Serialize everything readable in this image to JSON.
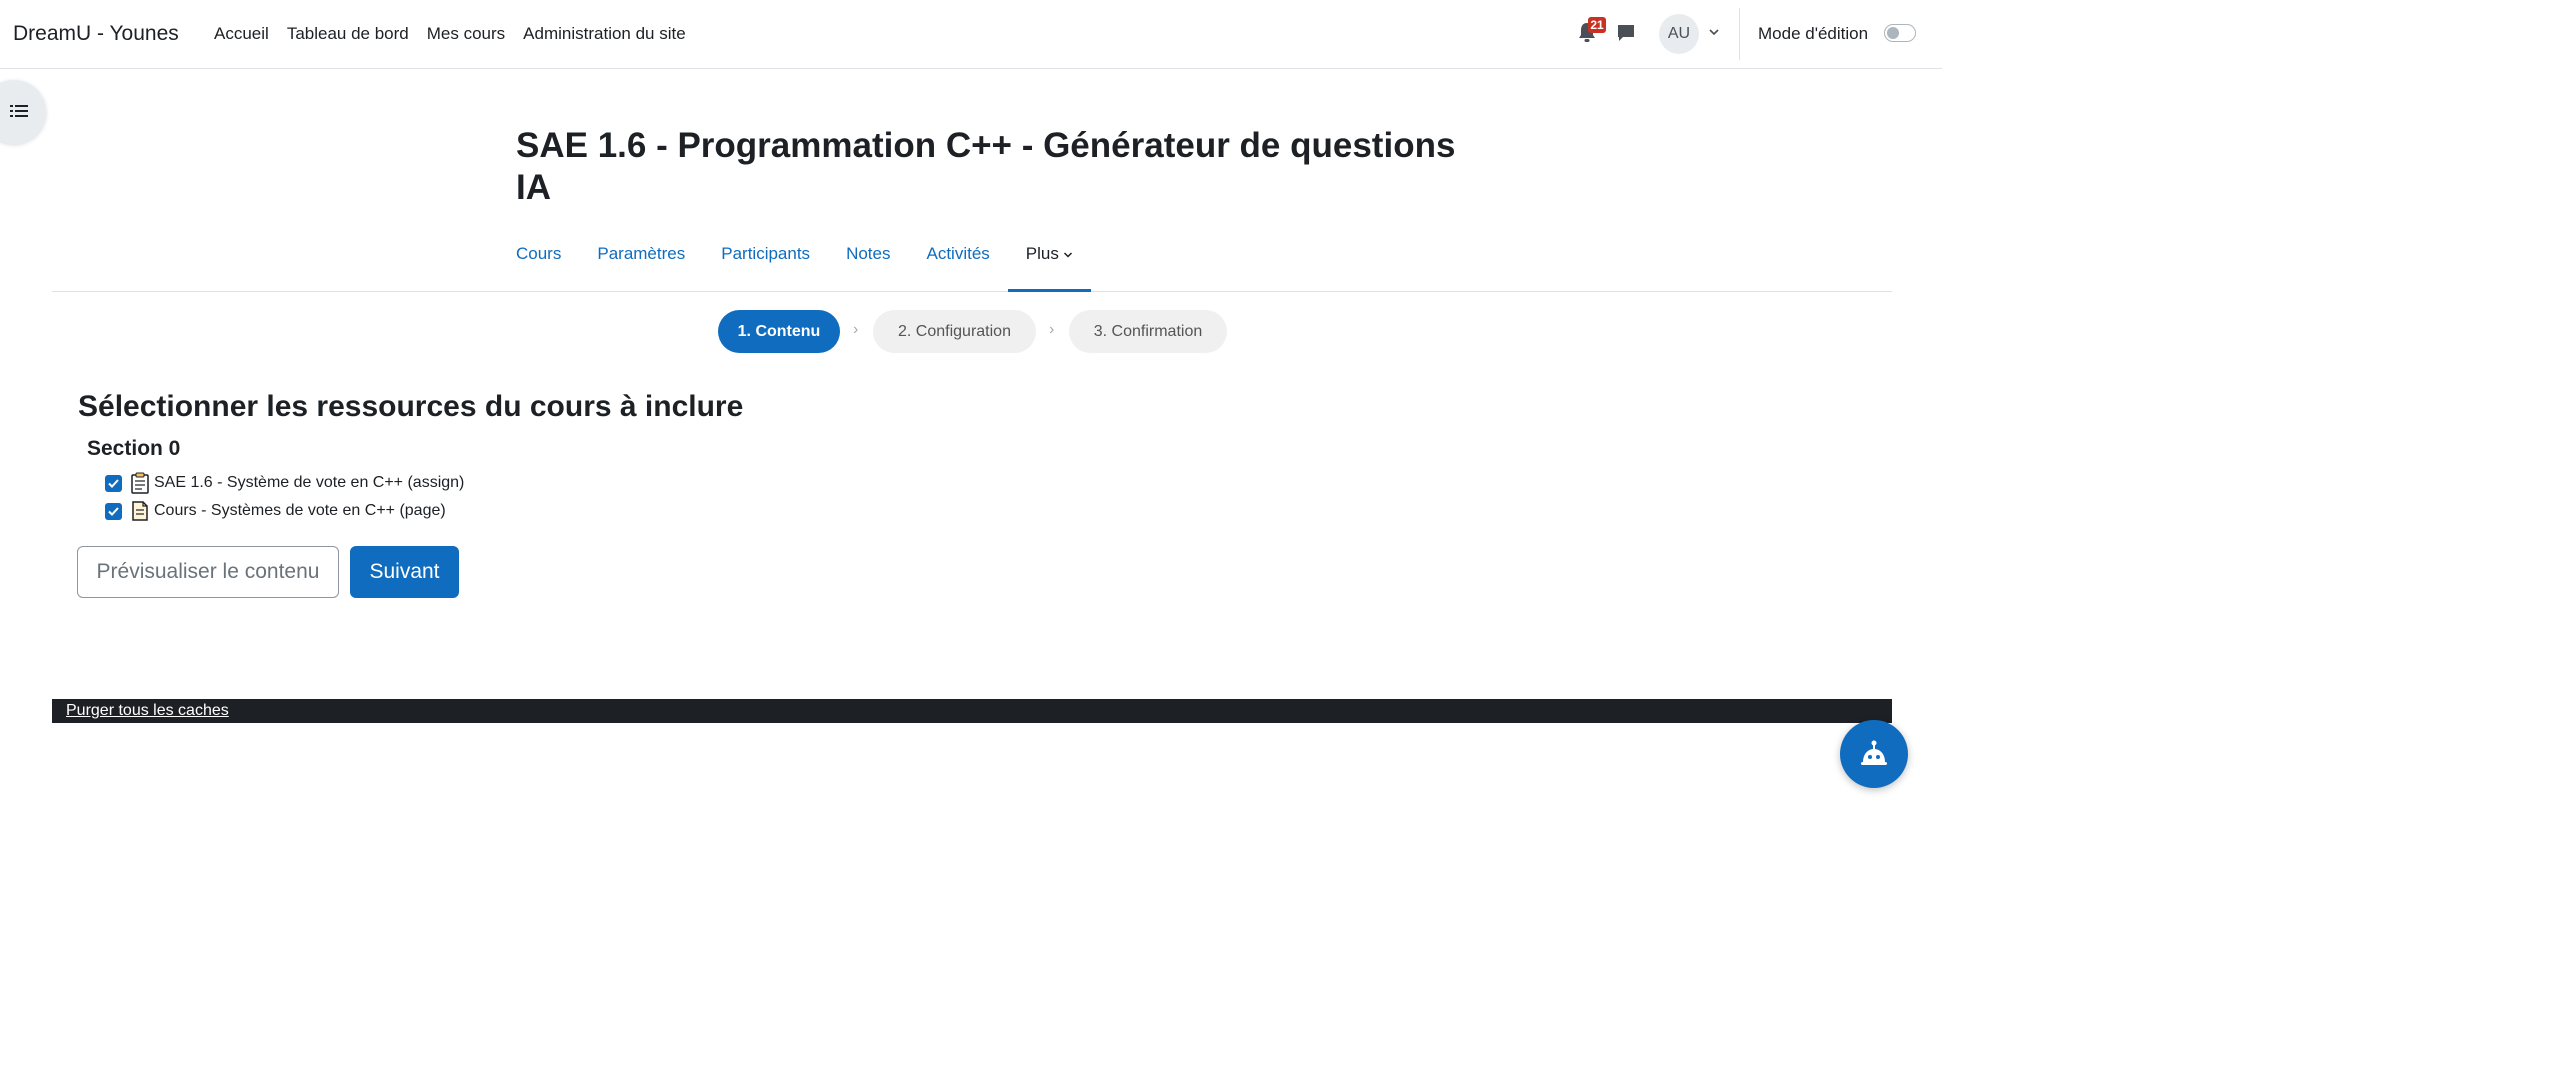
{
  "navbar": {
    "brand": "DreamU - Younes",
    "links": [
      "Accueil",
      "Tableau de bord",
      "Mes cours",
      "Administration du site"
    ],
    "notification_count": "21",
    "avatar_initials": "AU",
    "edit_mode_label": "Mode d'édition",
    "edit_mode_on": false
  },
  "page": {
    "title": "SAE 1.6 - Programmation C++ - Générateur de questions IA"
  },
  "course_nav": {
    "tabs": [
      "Cours",
      "Paramètres",
      "Participants",
      "Notes",
      "Activités",
      "Plus"
    ],
    "active": "Plus"
  },
  "stepper": {
    "steps": [
      "1. Contenu",
      "2. Configuration",
      "3. Confirmation"
    ],
    "separator": "›",
    "active_step": 1
  },
  "content": {
    "heading": "Sélectionner les ressources du cours à inclure",
    "section_title": "Section 0",
    "resources": [
      {
        "label": "SAE 1.6 - Système de vote en C++ (assign)",
        "checked": true,
        "icon": "assignment-icon"
      },
      {
        "label": "Cours - Systèmes de vote en C++ (page)",
        "checked": true,
        "icon": "page-icon"
      }
    ],
    "preview_button": "Prévisualiser le contenu",
    "next_button": "Suivant"
  },
  "footer": {
    "purge_link": "Purger tous les caches"
  },
  "colors": {
    "primary": "#0f6cbf",
    "footer_bg": "#1d2125",
    "badge": "#ca3120"
  }
}
